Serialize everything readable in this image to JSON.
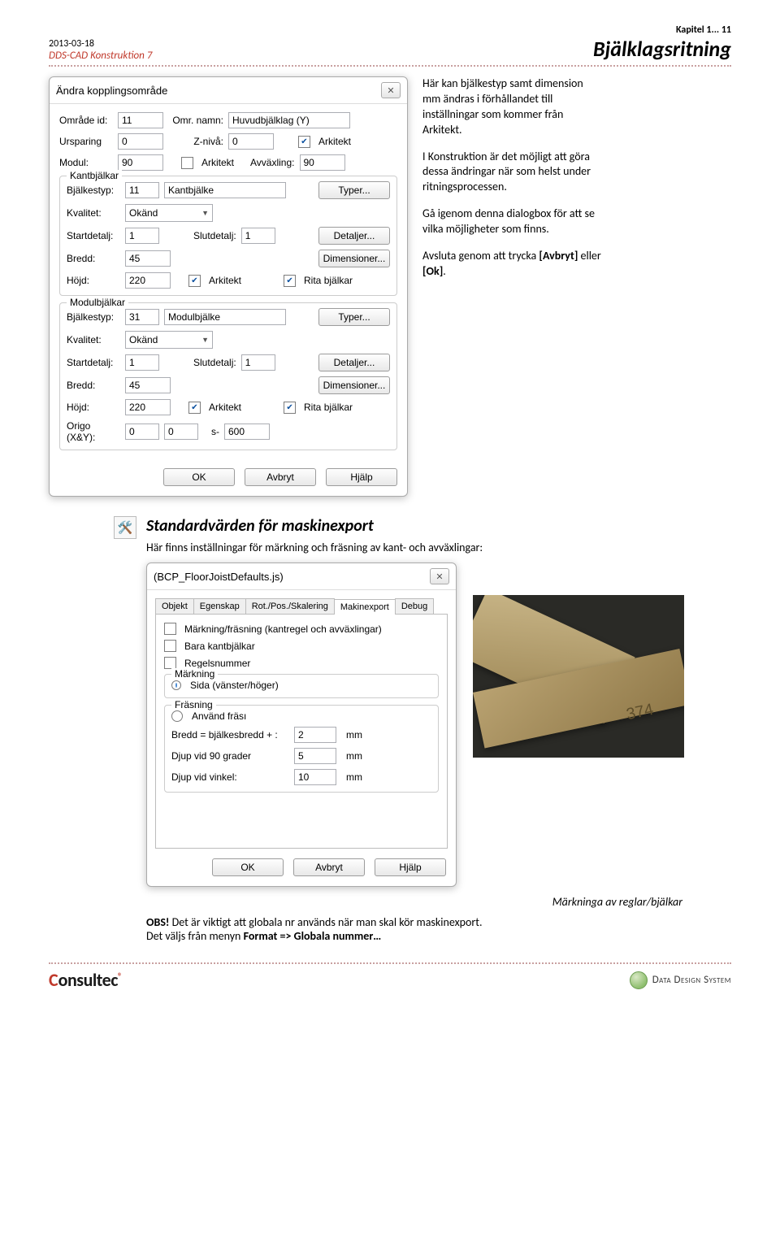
{
  "header": {
    "date": "2013-03-18",
    "product": "DDS-CAD Konstruktion 7",
    "chapter": "Kapitel 1... 11",
    "title": "Bjälklagsritning"
  },
  "sidetext": {
    "p1": "Här kan bjälkestyp samt dimension mm ändras i förhållandet till inställningar som kommer från Arkitekt.",
    "p2": "I Konstruktion är det möjligt att göra dessa ändringar när som helst under ritningsprocessen.",
    "p3": "Gå igenom denna dialogbox för att se vilka möjligheter som finns.",
    "p4a": "Avsluta genom att trycka ",
    "p4b": "[Avbryt]",
    "p4c": " eller ",
    "p4d": "[Ok]",
    "p4e": "."
  },
  "dlg1": {
    "title": "Ändra kopplingsområde",
    "close_icon": "✕",
    "labels": {
      "omrade": "Område id:",
      "ursp": "Ursparing",
      "modul": "Modul:",
      "omrnamn": "Omr. namn:",
      "zniva": "Z-nivå:",
      "arkitekt": "Arkitekt",
      "avvax": "Avväxling:",
      "bjalkestyp": "Bjälkestyp:",
      "kvalitet": "Kvalitet:",
      "startd": "Startdetalj:",
      "slutd": "Slutdetalj:",
      "bredd": "Bredd:",
      "hojd": "Höjd:",
      "rita": "Rita bjälkar",
      "origo": "Origo (X&Y):",
      "ss": "s-"
    },
    "sections": {
      "kant": "Kantbjälkar",
      "modul": "Modulbjälkar"
    },
    "values": {
      "omrade": "11",
      "ursp": "0",
      "modul": "90",
      "omrnamn": "Huvudbjälklag (Y)",
      "zniva": "0",
      "avvax": "90",
      "k_bjalkestyp": "11",
      "k_bjalke_txt": "Kantbjälke",
      "k_kval": "Okänd",
      "k_start": "1",
      "k_slut": "1",
      "k_bredd": "45",
      "k_hojd": "220",
      "m_bjalkestyp": "31",
      "m_bjalke_txt": "Modulbjälke",
      "m_kval": "Okänd",
      "m_start": "1",
      "m_slut": "1",
      "m_bredd": "45",
      "m_hojd": "220",
      "origo_x": "0",
      "origo_y": "0",
      "ss": "600"
    },
    "buttons": {
      "typer": "Typer...",
      "detaljer": "Detaljer...",
      "dim": "Dimensioner...",
      "ok": "OK",
      "avbryt": "Avbryt",
      "hjalp": "Hjälp"
    }
  },
  "section2": {
    "heading": "Standardvärden för maskinexport",
    "desc": "Här finns inställningar för märkning och fräsning av kant- och avväxlingar:"
  },
  "dlg2": {
    "title": "(BCP_FloorJoistDefaults.js)",
    "close_icon": "✕",
    "tabs": [
      "Objekt",
      "Egenskap",
      "Rot./Pos./Skalering",
      "Makinexport",
      "Debug"
    ],
    "c1": "Märkning/fräsning (kantregel och avväxlingar)",
    "c2": "Bara kantbjälkar",
    "c3": "Regelsnummer",
    "g_mark": "Märkning",
    "r1": "Sida (vänster/höger)",
    "g_fras": "Fräsning",
    "r2": "Använd fräsı",
    "bredd_lbl": "Bredd = bjälkesbredd + :",
    "bredd_v": "2",
    "d90_lbl": "Djup vid 90 grader",
    "d90_v": "5",
    "dvk_lbl": "Djup vid vinkel:",
    "dvk_v": "10",
    "mm": "mm",
    "ok": "OK",
    "avbryt": "Avbryt",
    "hjalp": "Hjälp"
  },
  "photo": {
    "mark": "374"
  },
  "caption": "Märkninga av reglar/bjälkar",
  "obs": {
    "b1": "OBS!",
    "t1": " Det är viktigt att globala nr används när man skal kör maskinexport.",
    "t2": "Det väljs från menyn ",
    "b2": "Format => Globala nummer…"
  },
  "footer": {
    "logo_c": "C",
    "logo_rest": "onsultec",
    "reg": "®",
    "dds": "Data Design System"
  }
}
